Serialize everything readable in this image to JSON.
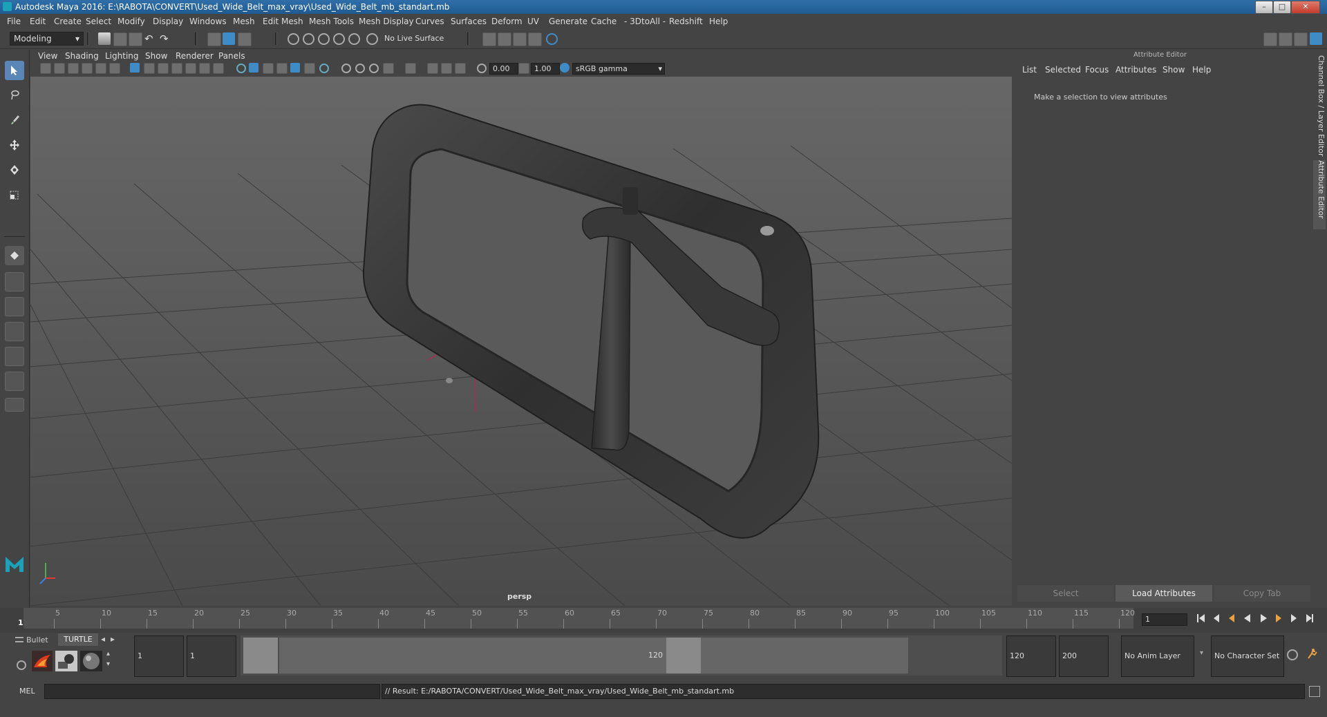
{
  "titlebar": {
    "title": "Autodesk Maya 2016: E:\\RABOTA\\CONVERT\\Used_Wide_Belt_max_vray\\Used_Wide_Belt_mb_standart.mb"
  },
  "menubar": {
    "items": [
      "File",
      "Edit",
      "Create",
      "Select",
      "Modify",
      "Display",
      "Windows",
      "Mesh",
      "Edit Mesh",
      "Mesh Tools",
      "Mesh Display",
      "Curves",
      "Surfaces",
      "Deform",
      "UV",
      "Generate",
      "Cache",
      "- 3DtoAll -",
      "Redshift",
      "Help"
    ]
  },
  "shelf": {
    "mode": "Modeling",
    "live_surface": "No Live Surface"
  },
  "viewport": {
    "menu": [
      "View",
      "Shading",
      "Lighting",
      "Show",
      "Renderer",
      "Panels"
    ],
    "exposure": "0.00",
    "gamma": "1.00",
    "color_space": "sRGB gamma",
    "camera_label": "persp"
  },
  "attribute_editor": {
    "header": "Attribute Editor",
    "menu": [
      "List",
      "Selected",
      "Focus",
      "Attributes",
      "Show",
      "Help"
    ],
    "message": "Make a selection to view attributes",
    "buttons": {
      "select": "Select",
      "load": "Load Attributes",
      "copy": "Copy Tab"
    }
  },
  "side_tabs": {
    "channel_box": "Channel Box / Layer Editor",
    "attribute_editor": "Attribute Editor"
  },
  "timeline": {
    "ticks": [
      "5",
      "10",
      "15",
      "20",
      "25",
      "30",
      "35",
      "40",
      "45",
      "50",
      "55",
      "60",
      "65",
      "70",
      "75",
      "80",
      "85",
      "90",
      "95",
      "100",
      "105",
      "110",
      "115",
      "120"
    ],
    "current_marker": "1",
    "current_frame": "1"
  },
  "range": {
    "shelf_tabs": [
      "Bullet",
      "TURTLE"
    ],
    "start_frame": "1",
    "range_start": "1",
    "slider_start": "1",
    "slider_end": "120",
    "range_end": "120",
    "end_frame": "200",
    "anim_layer": "No Anim Layer",
    "character_set": "No Character Set"
  },
  "command": {
    "label": "MEL",
    "result": "// Result: E:/RABOTA/CONVERT/Used_Wide_Belt_max_vray/Used_Wide_Belt_mb_standart.mb"
  }
}
